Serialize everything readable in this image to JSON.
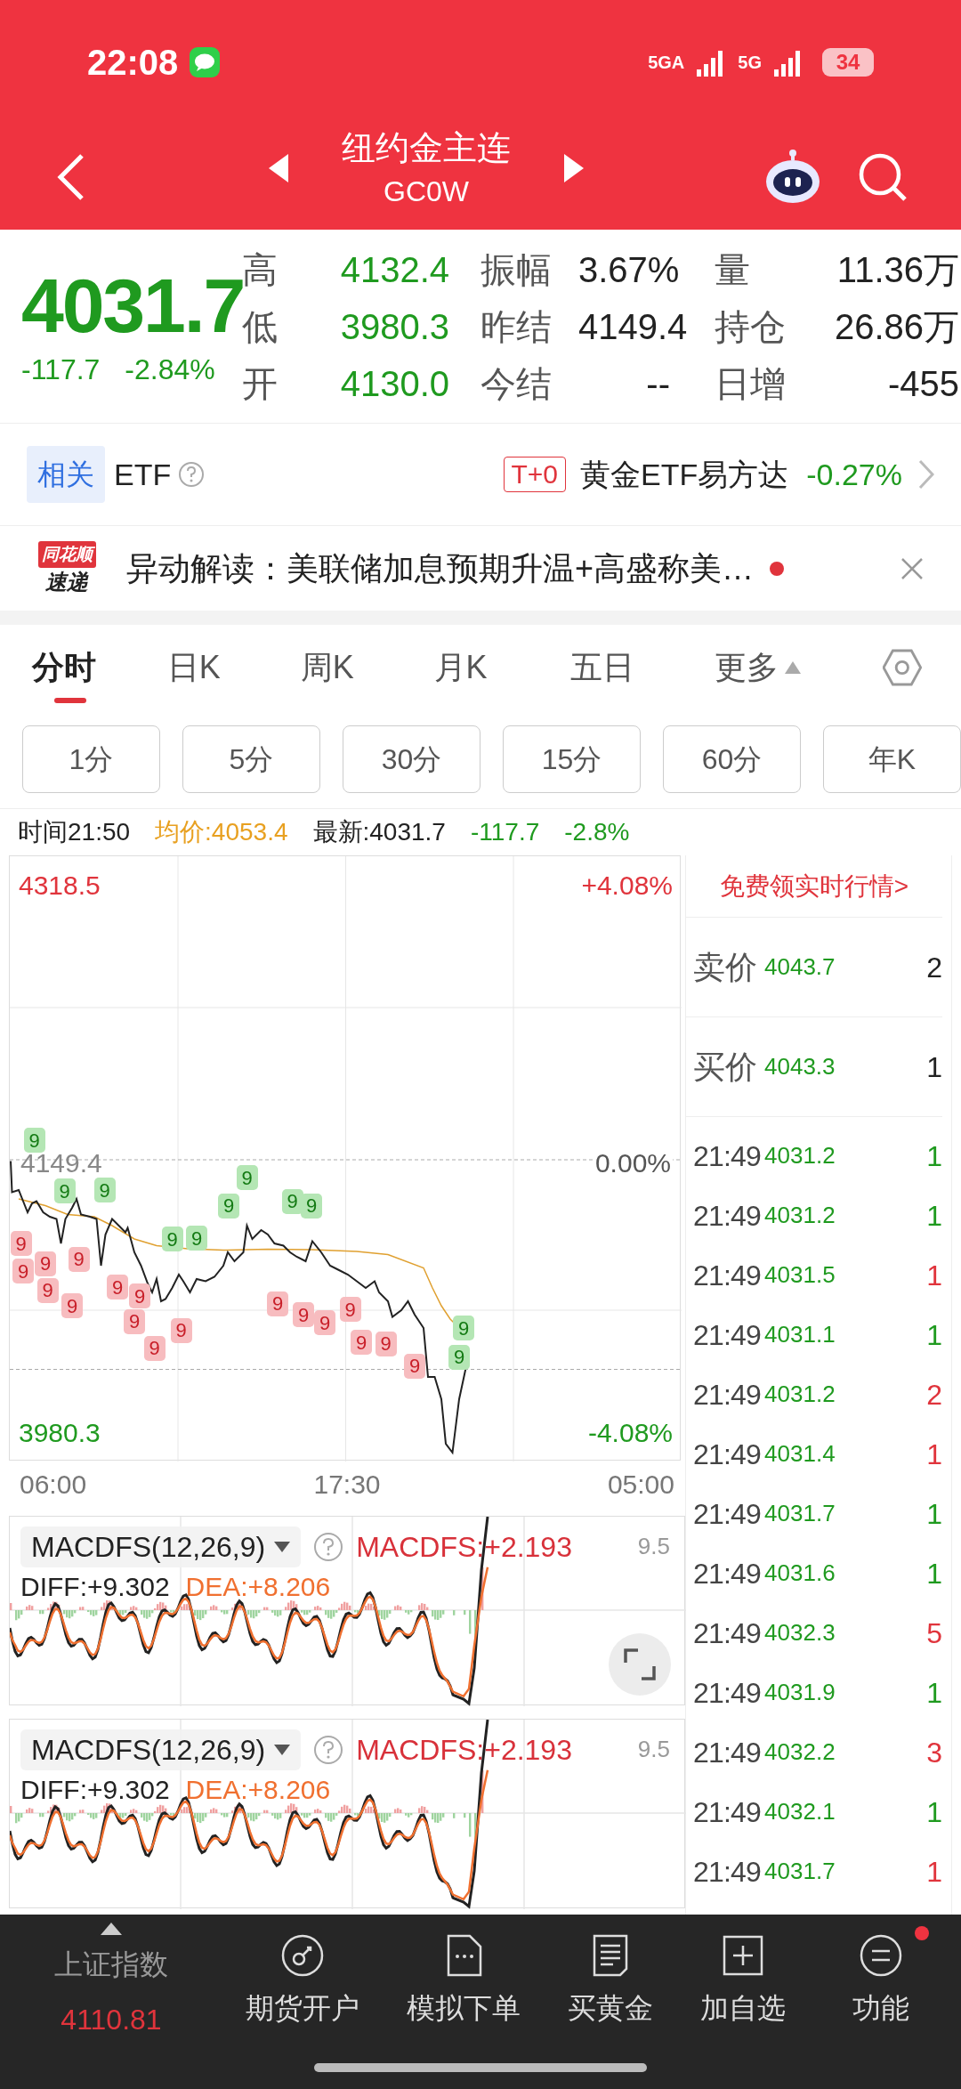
{
  "status_bar": {
    "time": "22:08",
    "network_1": "5GA",
    "network_2": "5G",
    "battery": "34"
  },
  "header": {
    "title": "纽约金主连",
    "code": "GC0W"
  },
  "quote": {
    "price": "4031.7",
    "change": "-117.7",
    "change_pct": "-2.84%",
    "stats": [
      {
        "label": "高",
        "value": "4132.4",
        "color": "#1f9a1f"
      },
      {
        "label": "振幅",
        "value": "3.67%",
        "color": "#222222"
      },
      {
        "label": "量",
        "value": "11.36万",
        "color": "#222222"
      },
      {
        "label": "低",
        "value": "3980.3",
        "color": "#1f9a1f"
      },
      {
        "label": "昨结",
        "value": "4149.4",
        "color": "#222222"
      },
      {
        "label": "持仓",
        "value": "26.86万",
        "color": "#222222"
      },
      {
        "label": "开",
        "value": "4130.0",
        "color": "#1f9a1f"
      },
      {
        "label": "今结",
        "value": "--",
        "color": "#222222"
      },
      {
        "label": "日增",
        "value": "-455",
        "color": "#222222"
      }
    ]
  },
  "related": {
    "tag": "相关",
    "label": "ETF",
    "badge": "T+0",
    "fund": "黄金ETF易方达",
    "change": "-0.27%"
  },
  "news": {
    "logo_top": "同花顺",
    "logo_bottom": "速递",
    "text": "异动解读：美联储加息预期升温+高盛称美…",
    "unread": true
  },
  "chart_tabs": [
    {
      "label": "分时",
      "selected": true
    },
    {
      "label": "日K",
      "selected": false
    },
    {
      "label": "周K",
      "selected": false
    },
    {
      "label": "月K",
      "selected": false
    },
    {
      "label": "五日",
      "selected": false
    },
    {
      "label": "更多",
      "selected": false
    }
  ],
  "periods": [
    "1分",
    "5分",
    "30分",
    "15分",
    "60分",
    "年K"
  ],
  "info": {
    "time": "时间21:50",
    "avg": "均价:4053.4",
    "latest": "最新:4031.7",
    "change": "-117.7",
    "change_pct": "-2.8%"
  },
  "price_chart": {
    "high": "4318.5",
    "high_pct": "+4.08%",
    "prev_close": "4149.4",
    "zero_pct": "0.00%",
    "low": "3980.3",
    "low_pct": "-4.08%",
    "x_labels": [
      "06:00",
      "17:30",
      "05:00"
    ],
    "signals": [
      {
        "label": "9",
        "kind": "top"
      },
      {
        "label": "9",
        "kind": "top"
      },
      {
        "label": "9",
        "kind": "top"
      },
      {
        "label": "9",
        "kind": "top"
      },
      {
        "label": "9",
        "kind": "top"
      },
      {
        "label": "9",
        "kind": "top"
      },
      {
        "label": "9",
        "kind": "top"
      },
      {
        "label": "9",
        "kind": "top"
      },
      {
        "label": "9",
        "kind": "top"
      },
      {
        "label": "9",
        "kind": "top"
      },
      {
        "label": "9",
        "kind": "top"
      },
      {
        "label": "9",
        "kind": "bottom"
      },
      {
        "label": "9",
        "kind": "bottom"
      },
      {
        "label": "9",
        "kind": "bottom"
      },
      {
        "label": "9",
        "kind": "bottom"
      },
      {
        "label": "9",
        "kind": "bottom"
      },
      {
        "label": "9",
        "kind": "bottom"
      },
      {
        "label": "9",
        "kind": "bottom"
      },
      {
        "label": "9",
        "kind": "bottom"
      },
      {
        "label": "9",
        "kind": "bottom"
      },
      {
        "label": "9",
        "kind": "bottom"
      },
      {
        "label": "9",
        "kind": "bottom"
      },
      {
        "label": "9",
        "kind": "bottom"
      },
      {
        "label": "9",
        "kind": "bottom"
      },
      {
        "label": "9",
        "kind": "bottom"
      },
      {
        "label": "9",
        "kind": "bottom"
      },
      {
        "label": "9",
        "kind": "bottom"
      },
      {
        "label": "9",
        "kind": "bottom"
      },
      {
        "label": "9",
        "kind": "bottom"
      }
    ]
  },
  "quote_panel": {
    "link": "免费领实时行情>",
    "ask_label": "卖价",
    "ask": "4043.7",
    "ask_size": "2",
    "bid_label": "买价",
    "bid": "4043.3",
    "bid_size": "1",
    "trades": [
      {
        "time": "21:49",
        "price": "4031.2",
        "volume": "1",
        "color": "#1f9a1f"
      },
      {
        "time": "21:49",
        "price": "4031.2",
        "volume": "1",
        "color": "#1f9a1f"
      },
      {
        "time": "21:49",
        "price": "4031.5",
        "volume": "1",
        "color": "#e0343c"
      },
      {
        "time": "21:49",
        "price": "4031.1",
        "volume": "1",
        "color": "#1f9a1f"
      },
      {
        "time": "21:49",
        "price": "4031.2",
        "volume": "2",
        "color": "#e0343c"
      },
      {
        "time": "21:49",
        "price": "4031.4",
        "volume": "1",
        "color": "#e0343c"
      },
      {
        "time": "21:49",
        "price": "4031.7",
        "volume": "1",
        "color": "#1f9a1f"
      },
      {
        "time": "21:49",
        "price": "4031.6",
        "volume": "1",
        "color": "#1f9a1f"
      },
      {
        "time": "21:49",
        "price": "4032.3",
        "volume": "5",
        "color": "#e0343c"
      },
      {
        "time": "21:49",
        "price": "4031.9",
        "volume": "1",
        "color": "#1f9a1f"
      },
      {
        "time": "21:49",
        "price": "4032.2",
        "volume": "3",
        "color": "#e0343c"
      },
      {
        "time": "21:49",
        "price": "4032.1",
        "volume": "1",
        "color": "#1f9a1f"
      },
      {
        "time": "21:49",
        "price": "4031.7",
        "volume": "1",
        "color": "#e0343c"
      }
    ]
  },
  "indicators": [
    {
      "name": "MACDFS(12,26,9)",
      "value": "MACDFS:+2.193",
      "scale": "9.5",
      "diff": "DIFF:+9.302",
      "dea": "DEA:+8.206",
      "expand": true
    },
    {
      "name": "MACDFS(12,26,9)",
      "value": "MACDFS:+2.193",
      "scale": "9.5",
      "diff": "DIFF:+9.302",
      "dea": "DEA:+8.206",
      "expand": false
    }
  ],
  "bottom_bar": {
    "index_name": "上证指数",
    "index_value": "4110.81",
    "actions": [
      {
        "label": "期货开户",
        "kind": "account",
        "badge": false
      },
      {
        "label": "模拟下单",
        "kind": "simulate",
        "badge": false
      },
      {
        "label": "买黄金",
        "kind": "gold",
        "badge": false
      },
      {
        "label": "加自选",
        "kind": "add",
        "badge": false
      },
      {
        "label": "功能",
        "kind": "menu",
        "badge": true
      }
    ]
  }
}
